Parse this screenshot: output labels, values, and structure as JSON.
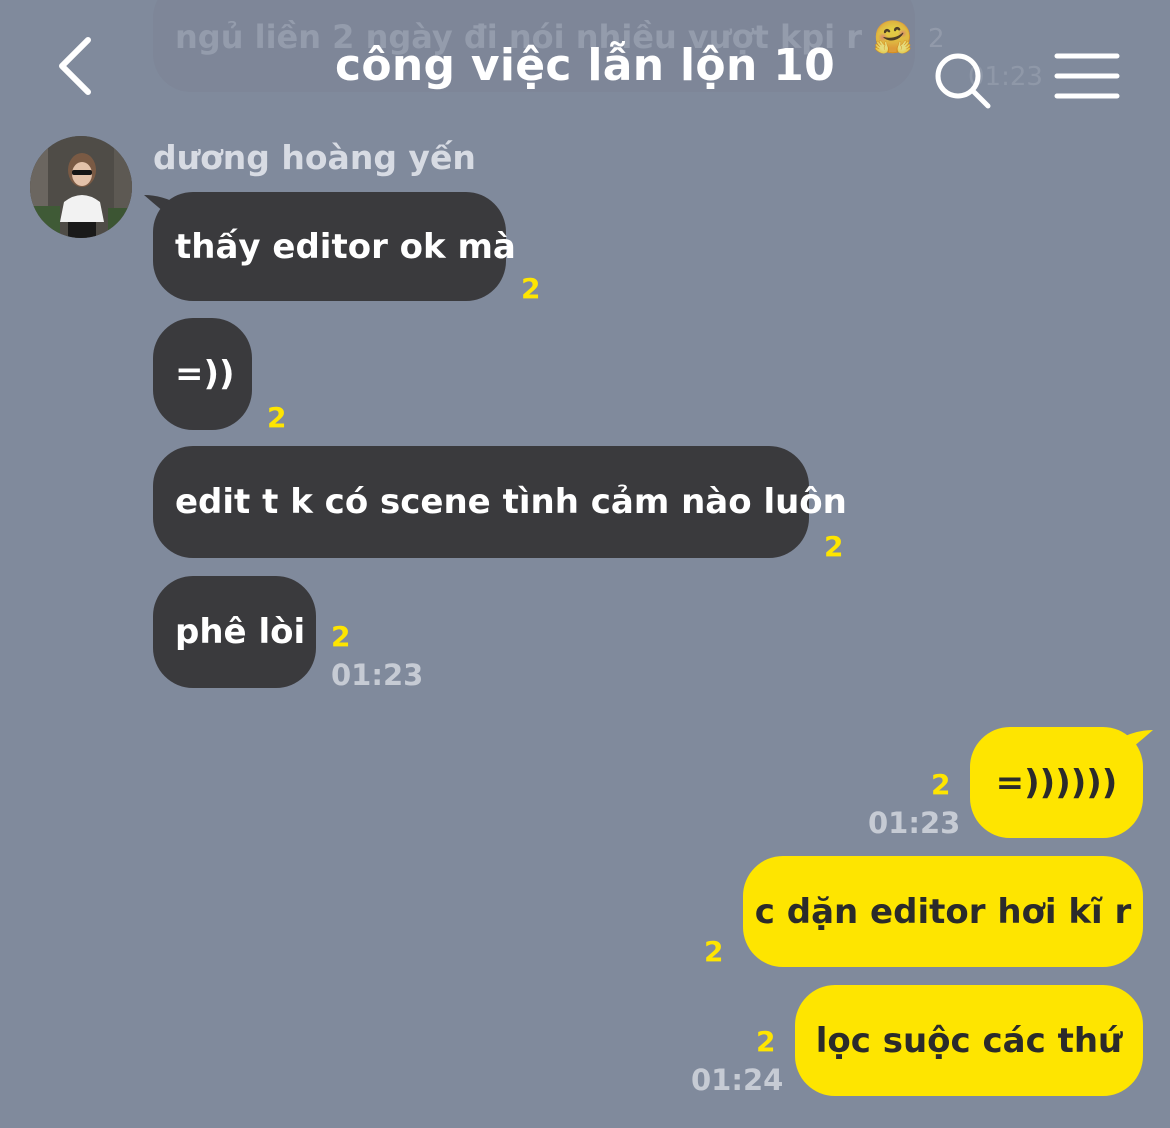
{
  "header": {
    "title": "công việc lẫn lộn 10",
    "back_icon": "chevron-left-icon",
    "search_icon": "search-icon",
    "menu_icon": "hamburger-menu-icon"
  },
  "previous_message": {
    "text": "ngủ liền 2 ngày đi nói nhiều vượt kpi r 🤗",
    "read_count": "2",
    "time": "01:23"
  },
  "incoming": {
    "sender_name": "dương hoàng yến",
    "avatar": "avatar",
    "messages": [
      {
        "text": "thấy editor ok mà",
        "read_count": "2"
      },
      {
        "text": "=))",
        "read_count": "2"
      },
      {
        "text": "edit t k có scene tình cảm nào luôn",
        "read_count": "2"
      },
      {
        "text": "phê lòi",
        "read_count": "2",
        "time": "01:23"
      }
    ]
  },
  "outgoing": {
    "messages": [
      {
        "text": "=))))))",
        "read_count": "2",
        "time": "01:23"
      },
      {
        "text": "c dặn editor hơi kĩ r",
        "read_count": "2"
      },
      {
        "text": "lọc suộc các thứ",
        "read_count": "2",
        "time": "01:24"
      }
    ]
  },
  "colors": {
    "background": "#808a9c",
    "incoming_bubble": "#3a3a3d",
    "outgoing_bubble": "#fee500",
    "read_count": "#fee500"
  }
}
